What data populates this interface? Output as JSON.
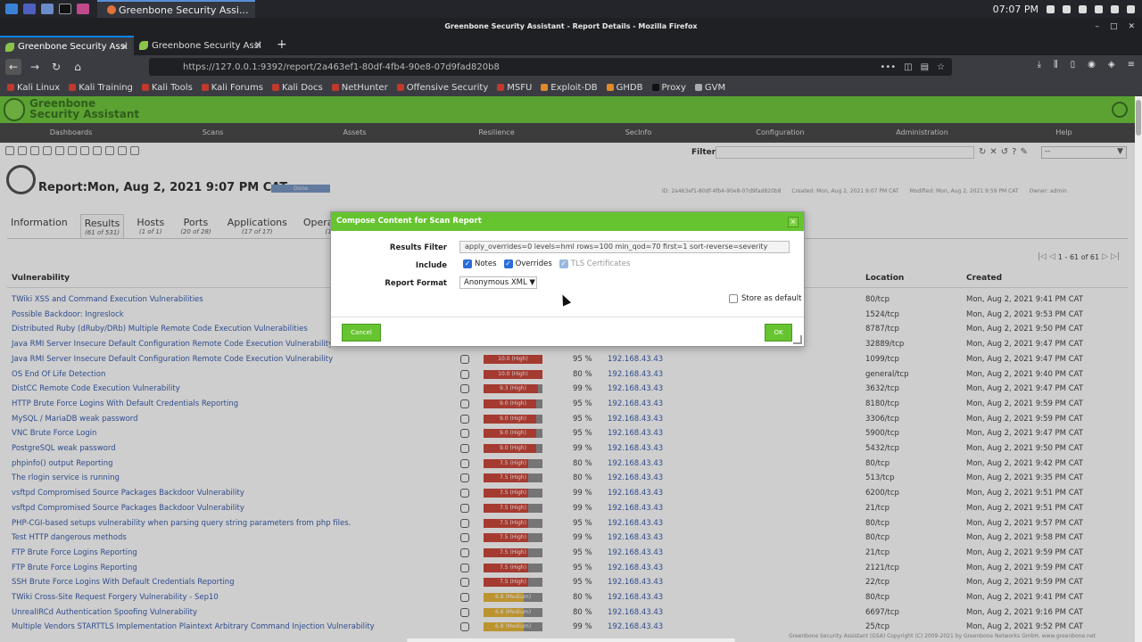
{
  "os": {
    "window_title": "Greenbone Security Assi...",
    "clock": "07:07 PM"
  },
  "browser": {
    "title": "Greenbone Security Assistant - Report Details - Mozilla Firefox",
    "tabs": [
      {
        "label": "Greenbone Security Assi"
      },
      {
        "label": "Greenbone Security Assi"
      }
    ],
    "url": "https://127.0.0.1:9392/report/2a463ef1-80df-4fb4-90e8-07d9fad820b8",
    "bookmarks": [
      "Kali Linux",
      "Kali Training",
      "Kali Tools",
      "Kali Forums",
      "Kali Docs",
      "NetHunter",
      "Offensive Security",
      "MSFU",
      "Exploit-DB",
      "GHDB",
      "Proxy",
      "GVM"
    ]
  },
  "gsa": {
    "logo_line1": "Greenbone",
    "logo_line2": "Security Assistant",
    "menu": [
      "Dashboards",
      "Scans",
      "Assets",
      "Resilience",
      "SecInfo",
      "Configuration",
      "Administration",
      "Help"
    ],
    "filter_label": "Filter",
    "filter_select": "--"
  },
  "report": {
    "title": "Report:Mon, Aug 2, 2021 9:07 PM CAT",
    "status": "Done",
    "status_progress": 100,
    "meta_id": "ID: 2a463ef1-80df-4fb4-90e8-07d9fad820b8",
    "meta_created": "Created: Mon, Aug 2, 2021 9:07 PM CAT",
    "meta_modified": "Modified: Mon, Aug 2, 2021 9:59 PM CAT",
    "meta_owner": "Owner: admin",
    "tabs": [
      {
        "label": "Information",
        "count": ""
      },
      {
        "label": "Results",
        "count": "(61 of 531)"
      },
      {
        "label": "Hosts",
        "count": "(1 of 1)"
      },
      {
        "label": "Ports",
        "count": "(20 of 28)"
      },
      {
        "label": "Applications",
        "count": "(17 of 17)"
      },
      {
        "label": "Operating S",
        "count": "(1 of"
      }
    ],
    "pagination": "1 - 61 of 61"
  },
  "table": {
    "headers": {
      "vulnerability": "Vulnerability",
      "location": "Location",
      "created": "Created"
    },
    "rows": [
      {
        "name": "TWiki XSS and Command Execution Vulnerabilities",
        "severity": "",
        "sev_value": 0,
        "qod": "",
        "host": "",
        "location": "80/tcp",
        "created": "Mon, Aug 2, 2021 9:41 PM CAT"
      },
      {
        "name": "Possible Backdoor: Ingreslock",
        "severity": "",
        "sev_value": 0,
        "qod": "",
        "host": "",
        "location": "1524/tcp",
        "created": "Mon, Aug 2, 2021 9:53 PM CAT"
      },
      {
        "name": "Distributed Ruby (dRuby/DRb) Multiple Remote Code Execution Vulnerabilities",
        "severity": "",
        "sev_value": 0,
        "qod": "",
        "host": "",
        "location": "8787/tcp",
        "created": "Mon, Aug 2, 2021 9:50 PM CAT"
      },
      {
        "name": "Java RMI Server Insecure Default Configuration Remote Code Execution Vulnerability",
        "severity": "",
        "sev_value": 0,
        "qod": "",
        "host": "",
        "location": "32889/tcp",
        "created": "Mon, Aug 2, 2021 9:47 PM CAT"
      },
      {
        "name": "Java RMI Server Insecure Default Configuration Remote Code Execution Vulnerability",
        "severity": "10.0 (High)",
        "sev_value": 10.0,
        "qod": "95 %",
        "host": "192.168.43.43",
        "location": "1099/tcp",
        "created": "Mon, Aug 2, 2021 9:47 PM CAT"
      },
      {
        "name": "OS End Of Life Detection",
        "severity": "10.0 (High)",
        "sev_value": 10.0,
        "qod": "80 %",
        "host": "192.168.43.43",
        "location": "general/tcp",
        "created": "Mon, Aug 2, 2021 9:40 PM CAT"
      },
      {
        "name": "DistCC Remote Code Execution Vulnerability",
        "severity": "9.3 (High)",
        "sev_value": 9.3,
        "qod": "99 %",
        "host": "192.168.43.43",
        "location": "3632/tcp",
        "created": "Mon, Aug 2, 2021 9:47 PM CAT"
      },
      {
        "name": "HTTP Brute Force Logins With Default Credentials Reporting",
        "severity": "9.0 (High)",
        "sev_value": 9.0,
        "qod": "95 %",
        "host": "192.168.43.43",
        "location": "8180/tcp",
        "created": "Mon, Aug 2, 2021 9:59 PM CAT"
      },
      {
        "name": "MySQL / MariaDB weak password",
        "severity": "9.0 (High)",
        "sev_value": 9.0,
        "qod": "95 %",
        "host": "192.168.43.43",
        "location": "3306/tcp",
        "created": "Mon, Aug 2, 2021 9:59 PM CAT"
      },
      {
        "name": "VNC Brute Force Login",
        "severity": "9.0 (High)",
        "sev_value": 9.0,
        "qod": "95 %",
        "host": "192.168.43.43",
        "location": "5900/tcp",
        "created": "Mon, Aug 2, 2021 9:47 PM CAT"
      },
      {
        "name": "PostgreSQL weak password",
        "severity": "9.0 (High)",
        "sev_value": 9.0,
        "qod": "99 %",
        "host": "192.168.43.43",
        "location": "5432/tcp",
        "created": "Mon, Aug 2, 2021 9:50 PM CAT"
      },
      {
        "name": "phpinfo() output Reporting",
        "severity": "7.5 (High)",
        "sev_value": 7.5,
        "qod": "80 %",
        "host": "192.168.43.43",
        "location": "80/tcp",
        "created": "Mon, Aug 2, 2021 9:42 PM CAT"
      },
      {
        "name": "The rlogin service is running",
        "severity": "7.5 (High)",
        "sev_value": 7.5,
        "qod": "80 %",
        "host": "192.168.43.43",
        "location": "513/tcp",
        "created": "Mon, Aug 2, 2021 9:35 PM CAT"
      },
      {
        "name": "vsftpd Compromised Source Packages Backdoor Vulnerability",
        "severity": "7.5 (High)",
        "sev_value": 7.5,
        "qod": "99 %",
        "host": "192.168.43.43",
        "location": "6200/tcp",
        "created": "Mon, Aug 2, 2021 9:51 PM CAT"
      },
      {
        "name": "vsftpd Compromised Source Packages Backdoor Vulnerability",
        "severity": "7.5 (High)",
        "sev_value": 7.5,
        "qod": "99 %",
        "host": "192.168.43.43",
        "location": "21/tcp",
        "created": "Mon, Aug 2, 2021 9:51 PM CAT"
      },
      {
        "name": "PHP-CGI-based setups vulnerability when parsing query string parameters from php files.",
        "severity": "7.5 (High)",
        "sev_value": 7.5,
        "qod": "95 %",
        "host": "192.168.43.43",
        "location": "80/tcp",
        "created": "Mon, Aug 2, 2021 9:57 PM CAT"
      },
      {
        "name": "Test HTTP dangerous methods",
        "severity": "7.5 (High)",
        "sev_value": 7.5,
        "qod": "99 %",
        "host": "192.168.43.43",
        "location": "80/tcp",
        "created": "Mon, Aug 2, 2021 9:58 PM CAT"
      },
      {
        "name": "FTP Brute Force Logins Reporting",
        "severity": "7.5 (High)",
        "sev_value": 7.5,
        "qod": "95 %",
        "host": "192.168.43.43",
        "location": "21/tcp",
        "created": "Mon, Aug 2, 2021 9:59 PM CAT"
      },
      {
        "name": "FTP Brute Force Logins Reporting",
        "severity": "7.5 (High)",
        "sev_value": 7.5,
        "qod": "95 %",
        "host": "192.168.43.43",
        "location": "2121/tcp",
        "created": "Mon, Aug 2, 2021 9:59 PM CAT"
      },
      {
        "name": "SSH Brute Force Logins With Default Credentials Reporting",
        "severity": "7.5 (High)",
        "sev_value": 7.5,
        "qod": "95 %",
        "host": "192.168.43.43",
        "location": "22/tcp",
        "created": "Mon, Aug 2, 2021 9:59 PM CAT"
      },
      {
        "name": "TWiki Cross-Site Request Forgery Vulnerability - Sep10",
        "severity": "6.8 (Medium)",
        "sev_value": 6.8,
        "qod": "80 %",
        "host": "192.168.43.43",
        "location": "80/tcp",
        "created": "Mon, Aug 2, 2021 9:41 PM CAT"
      },
      {
        "name": "UnrealIRCd Authentication Spoofing Vulnerability",
        "severity": "6.8 (Medium)",
        "sev_value": 6.8,
        "qod": "80 %",
        "host": "192.168.43.43",
        "location": "6697/tcp",
        "created": "Mon, Aug 2, 2021 9:16 PM CAT"
      },
      {
        "name": "Multiple Vendors STARTTLS Implementation Plaintext Arbitrary Command Injection Vulnerability",
        "severity": "6.8 (Medium)",
        "sev_value": 6.8,
        "qod": "99 %",
        "host": "192.168.43.43",
        "location": "25/tcp",
        "created": "Mon, Aug 2, 2021 9:52 PM CAT"
      }
    ]
  },
  "footer": "Greenbone Security Assistant (GSA) Copyright (C) 2009-2021 by Greenbone Networks GmbH, www.greenbone.net",
  "dialog": {
    "title": "Compose Content for Scan Report",
    "results_filter_label": "Results Filter",
    "results_filter_value": "apply_overrides=0 levels=hml rows=100 min_qod=70 first=1 sort-reverse=severity",
    "include_label": "Include",
    "include_notes": "Notes",
    "include_overrides": "Overrides",
    "include_tls": "TLS Certificates",
    "report_format_label": "Report Format",
    "report_format_value": "Anonymous XML",
    "store_default": "Store as default",
    "cancel": "Cancel",
    "ok": "OK"
  }
}
